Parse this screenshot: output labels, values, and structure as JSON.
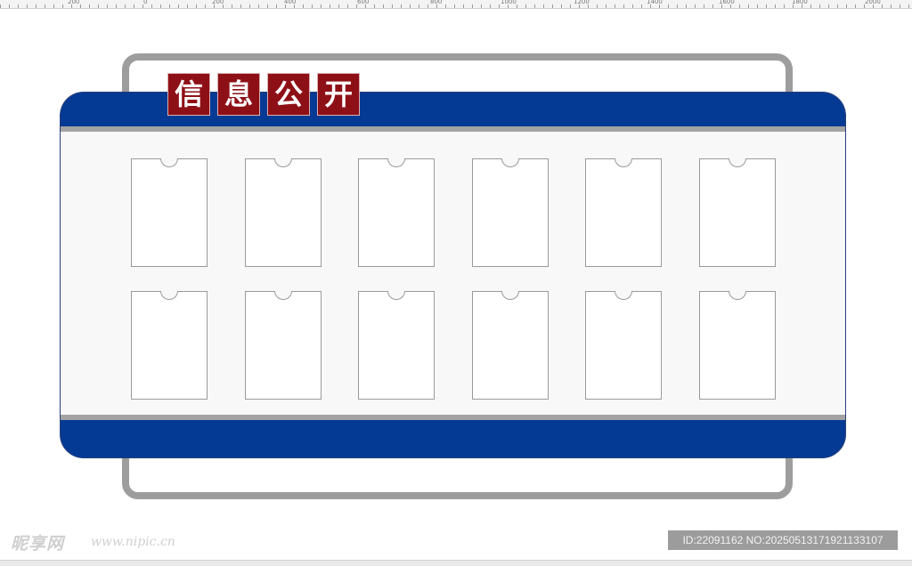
{
  "ruler": {
    "labels": [
      "200",
      "0",
      "200",
      "400",
      "600",
      "800",
      "1000",
      "1200",
      "1400",
      "1600",
      "1800",
      "2000"
    ]
  },
  "board": {
    "title_chars": [
      "信",
      "息",
      "公",
      "开"
    ],
    "pocket_rows": 2,
    "pockets_per_row": 6,
    "colors": {
      "blue_band": "#053a94",
      "title_red": "#8e1017",
      "frame_gray": "#9d9d9d",
      "panel": "#f8f8f8"
    }
  },
  "watermark": {
    "logo_text": "昵享网",
    "site_text": "www.nipic.cn",
    "id_text": "ID:22091162 NO:20250513171921133107"
  }
}
